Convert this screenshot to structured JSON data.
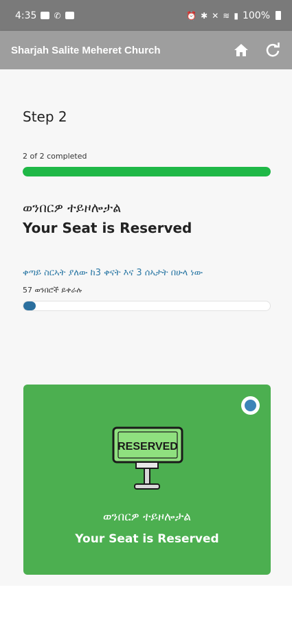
{
  "status_bar": {
    "time": "4:35",
    "battery": "100%"
  },
  "app_bar": {
    "title": "Sharjah Salite Meheret Church",
    "icons": [
      "home-icon",
      "refresh-icon"
    ]
  },
  "step": {
    "title": "Step 2",
    "completed_text": "2 of 2 completed",
    "progress_fraction": 1.0
  },
  "reservation": {
    "heading_amharic": "ወንበርዎ ተይዞሎታል",
    "heading_english": "Your Seat is Reserved",
    "countdown_text": "ቀጣይ ስርኣት ያለው ከ3 ቀናት እና 3 ሰኣታት በሁላ ነው",
    "seats_left_text": "57 ወንበሮች ይቀራሉ",
    "seats_progress_fraction": 0.05
  },
  "card": {
    "sign_text": "RESERVED",
    "label_amharic": "ወንበርዎ ተይዞሎታል",
    "label_english": "Your Seat is Reserved",
    "selected": true
  },
  "colors": {
    "status_bar": "#7a7a7a",
    "app_bar": "#9e9e9e",
    "progress_green": "#1fb847",
    "seat_progress_blue": "#2b6f9e",
    "card_green": "#4caf50",
    "sign_green": "#8fe07f",
    "radio_blue": "#3c84b8",
    "countdown_text": "#2f7aa6"
  }
}
